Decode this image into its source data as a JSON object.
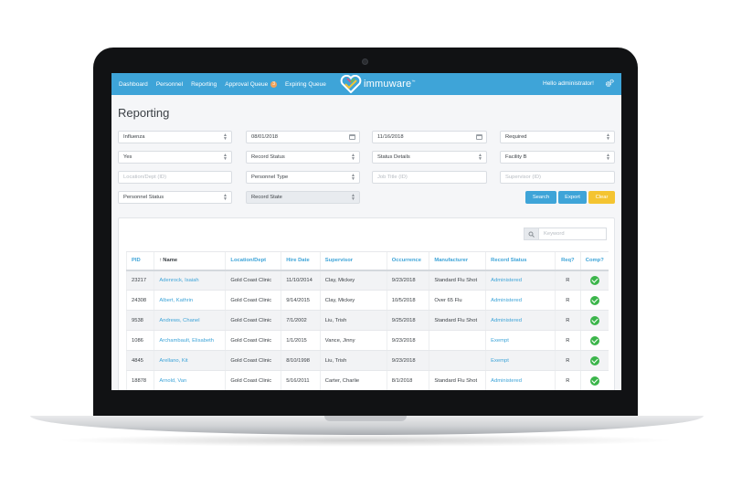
{
  "nav": {
    "items": [
      {
        "label": "Dashboard"
      },
      {
        "label": "Personnel"
      },
      {
        "label": "Reporting"
      },
      {
        "label": "Approval Queue",
        "badge": "3"
      },
      {
        "label": "Expiring Queue"
      }
    ],
    "logo_text": "immuware",
    "logo_tm": "™",
    "greeting": "Hello administrator!"
  },
  "page": {
    "title": "Reporting"
  },
  "filters": {
    "vaccine": "Influenza",
    "start_date": "08/01/2018",
    "end_date": "11/16/2018",
    "required": "Required",
    "answer": "Yes",
    "record_status": "Record Status",
    "status_details": "Status Details",
    "facility": "Facility B",
    "location_placeholder": "Location/Dept (ID)",
    "personnel_type": "Personnel Type",
    "job_title_placeholder": "Job Title (ID)",
    "supervisor_placeholder": "Supervisor (ID)",
    "personnel_status": "Personnel Status",
    "record_state": "Record State"
  },
  "buttons": {
    "search": "Search",
    "export": "Export",
    "clear": "Clear"
  },
  "keyword": {
    "placeholder": "Keyword"
  },
  "table": {
    "sort_indicator": "↑",
    "headers": {
      "pid": "PID",
      "name": "Name",
      "location": "Location/Dept",
      "hire_date": "Hire Date",
      "supervisor": "Supervisor",
      "occurrence": "Occurrence",
      "manufacturer": "Manufacturer",
      "record_status": "Record Status",
      "req": "Req?",
      "comp": "Comp?"
    },
    "rows": [
      {
        "pid": "23217",
        "name": "Adenrock, Isaiah",
        "location": "Gold Coast Clinic",
        "hire_date": "11/10/2014",
        "supervisor": "Clay, Mickey",
        "occurrence": "9/23/2018",
        "manufacturer": "Standard Flu Shot",
        "record_status": "Administered",
        "req": "R",
        "comp": true
      },
      {
        "pid": "24308",
        "name": "Albert, Kathrin",
        "location": "Gold Coast Clinic",
        "hire_date": "9/14/2015",
        "supervisor": "Clay, Mickey",
        "occurrence": "10/5/2018",
        "manufacturer": "Over 65 Flu",
        "record_status": "Administered",
        "req": "R",
        "comp": true
      },
      {
        "pid": "9538",
        "name": "Andrews, Chanel",
        "location": "Gold Coast Clinic",
        "hire_date": "7/1/2002",
        "supervisor": "Liu, Trish",
        "occurrence": "9/25/2018",
        "manufacturer": "Standard Flu Shot",
        "record_status": "Administered",
        "req": "R",
        "comp": true
      },
      {
        "pid": "1086",
        "name": "Archambault, Elisabeth",
        "location": "Gold Coast Clinic",
        "hire_date": "1/1/2015",
        "supervisor": "Vance, Jinny",
        "occurrence": "9/23/2018",
        "manufacturer": "",
        "record_status": "Exempt",
        "req": "R",
        "comp": true
      },
      {
        "pid": "4845",
        "name": "Arellano, Kit",
        "location": "Gold Coast Clinic",
        "hire_date": "8/10/1998",
        "supervisor": "Liu, Trish",
        "occurrence": "9/23/2018",
        "manufacturer": "",
        "record_status": "Exempt",
        "req": "R",
        "comp": true
      },
      {
        "pid": "18878",
        "name": "Arnold, Van",
        "location": "Gold Coast Clinic",
        "hire_date": "5/16/2011",
        "supervisor": "Carter, Charlie",
        "occurrence": "8/1/2018",
        "manufacturer": "Standard Flu Shot",
        "record_status": "Administered",
        "req": "R",
        "comp": true
      }
    ]
  },
  "colors": {
    "accent": "#3ea4d8",
    "clear_button": "#f4c431",
    "check": "#3bb54a",
    "badge": "#f0a35a"
  },
  "icons": {
    "gear": "gear-icon",
    "calendar": "calendar-icon",
    "search": "search-icon",
    "select_arrows": "select-arrows-icon",
    "check": "check-circle-icon",
    "logo": "heart-logo-icon"
  }
}
